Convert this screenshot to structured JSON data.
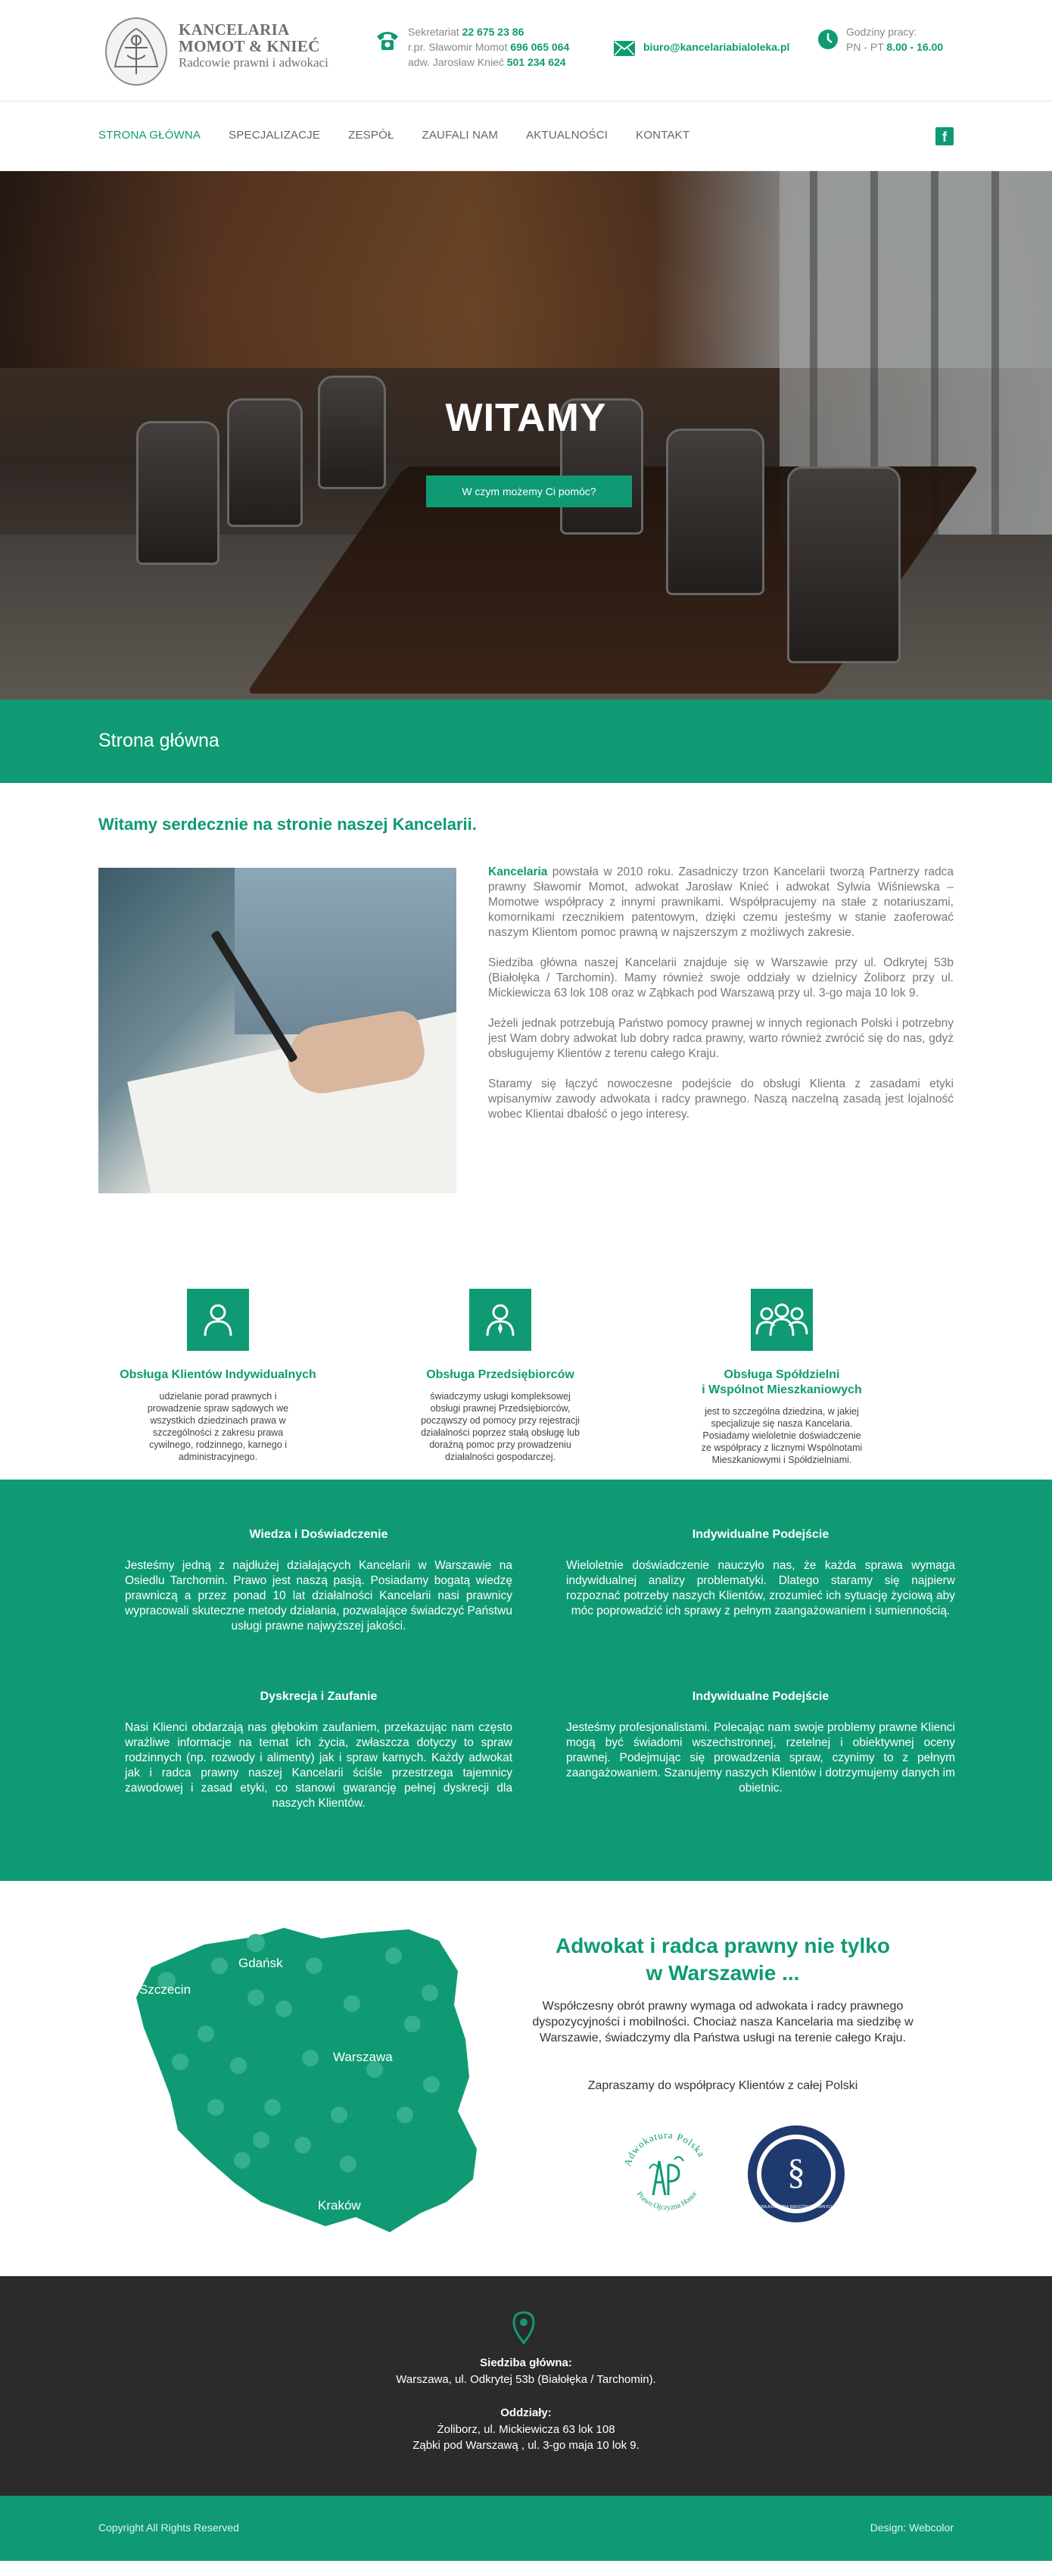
{
  "header": {
    "logo": {
      "line1": "KANCELARIA",
      "line2": "MOMOT & KNIEĆ",
      "line3": "Radcowie prawni i adwokaci"
    },
    "phone": {
      "label1": "Sekretariat",
      "num1": "22 675 23 86",
      "label2": "r.pr. Sławomir Momot",
      "num2": "696 065 064",
      "label3": "adw. Jarosław Knieć",
      "num3": "501 234 624"
    },
    "email": "biuro@kancelariabialoleka.pl",
    "hours": {
      "label": "Godziny pracy:",
      "days": "PN - PT",
      "time": "8.00 - 16.00"
    }
  },
  "nav": {
    "items": [
      {
        "label": "STRONA GŁÓWNA"
      },
      {
        "label": "SPECJALIZACJE"
      },
      {
        "label": "ZESPÓŁ"
      },
      {
        "label": "ZAUFALI NAM"
      },
      {
        "label": "AKTUALNOŚCI"
      },
      {
        "label": "KONTAKT"
      }
    ],
    "facebook": "f"
  },
  "hero": {
    "title": "WITAMY",
    "button": "W czym możemy Ci pomóc?"
  },
  "page_title": "Strona główna",
  "intro": {
    "heading": "Witamy serdecznie na stronie naszej Kancelarii.",
    "p1_bold": "Kancelaria",
    "p1": " powstała w 2010 roku. Zasadniczy trzon Kancelarii tworzą Partnerzy radca prawny Sławomir Momot, adwokat Jarosław Knieć i adwokat Sylwia Wiśniewska – Momotwe współpracy z innymi prawnikami. Współpracujemy na stałe z notariuszami, komornikami rzecznikiem patentowym, dzięki czemu jesteśmy w stanie zaoferować naszym Klientom pomoc prawną w najszerszym z możliwych zakresie.",
    "p2": "Siedziba główna naszej Kancelarii znajduje się w Warszawie przy ul. Odkrytej 53b (Białołęka / Tarchomin). Mamy również swoje oddziały w dzielnicy Żoliborz przy ul. Mickiewicza 63 lok 108 oraz w Ząbkach pod Warszawą przy ul. 3-go maja 10 lok 9.",
    "p3": "Jeżeli jednak potrzebują Państwo pomocy prawnej w innych regionach Polski i potrzebny jest Wam dobry adwokat lub dobry radca prawny, warto również zwrócić się do nas, gdyż obsługujemy Klientów z terenu całego Kraju.",
    "p4": "Staramy się łączyć nowoczesne podejście do obsługi Klienta z zasadami etyki wpisanymiw zawody adwokata i radcy prawnego. Naszą naczelną zasadą jest lojalność wobec Klientai dbałość o jego interesy."
  },
  "services": [
    {
      "title": "Obsługa Klientów Indywidualnych",
      "text": "udzielanie porad prawnych i prowadzenie spraw sądowych we wszystkich dziedzinach prawa w szczególności z zakresu prawa cywilnego, rodzinnego, karnego i administracyjnego."
    },
    {
      "title": "Obsługa Przedsiębiorców",
      "text": "świadczymy usługi kompleksowej obsługi prawnej Przedsiębiorców, począwszy od pomocy przy rejestracji działalności poprzez stałą obsługę lub doraźną pomoc przy prowadzeniu działalności gospodarczej."
    },
    {
      "title": "Obsługa Spółdzielni\ni Wspólnot Mieszkaniowych",
      "text": "jest to szczególna dziedzina, w jakiej specjalizuje się nasza Kancelaria. Posiadamy wieloletnie doświadczenie ze współpracy z licznymi Wspólnotami Mieszkaniowymi i Spółdzielniami."
    }
  ],
  "features": [
    {
      "title": "Wiedza i Doświadczenie",
      "text": "Jesteśmy jedną z najdłużej działających Kancelarii w Warszawie na Osiedlu Tarchomin. Prawo jest naszą pasją. Posiadamy bogatą wiedzę prawniczą a przez ponad 10 lat działalności Kancelarii nasi prawnicy wypracowali skuteczne metody działania, pozwalające świadczyć Państwu usługi prawne najwyższej jakości."
    },
    {
      "title": "Indywidualne Podejście",
      "text": "Wieloletnie doświadczenie nauczyło nas, że każda sprawa wymaga indywidualnej analizy problematyki. Dlatego staramy się najpierw rozpoznać potrzeby naszych Klientów, zrozumieć ich sytuację życiową aby móc poprowadzić ich sprawy z pełnym zaangażowaniem i sumiennością."
    },
    {
      "title": "Dyskrecja i Zaufanie",
      "text": "Nasi Klienci obdarzają nas głębokim zaufaniem, przekazując nam często wrażliwe informacje na temat ich życia, zwłaszcza dotyczy to spraw rodzinnych (np. rozwody i alimenty) jak i spraw karnych. Każdy adwokat jak i radca prawny naszej Kancelarii ściśle przestrzega tajemnicy zawodowej i zasad etyki, co stanowi gwarancję pełnej dyskrecji dla naszych Klientów."
    },
    {
      "title": "Indywidualne Podejście",
      "text": "Jesteśmy profesjonalistami. Polecając nam swoje problemy prawne Klienci mogą być świadomi wszechstronnej, rzetelnej i obiektywnej oceny prawnej. Podejmując się prowadzenia spraw, czynimy to z pełnym zaangażowaniem. Szanujemy naszych Klientów i dotrzymujemy danych im obietnic."
    }
  ],
  "map_section": {
    "cities": [
      "Gdańsk",
      "Szczecin",
      "Warszawa",
      "Kraków"
    ],
    "heading_l1": "Adwokat i radca prawny nie tylko",
    "heading_l2": "w Warszawie ...",
    "text": "Współczesny obrót prawny wymaga od adwokata i radcy prawnego dyspozycyjności i mobilności. Chociaż nasza Kancelaria ma siedzibę w Warszawie, świadczymy dla Państwa usługi na terenie całego Kraju.",
    "invite": "Zapraszamy do współpracy Klientów z całej Polski",
    "seal1_text": "Adwokatura Polska",
    "seal1_bottom": "Prawo Ojczyzna Honor",
    "seal2_text": "KRAJOWA IZBA RADCÓW PRAWNYCH"
  },
  "footer": {
    "hq_label": "Siedziba główna:",
    "hq_addr": "Warszawa, ul. Odkrytej 53b (Białołęka / Tarchomin).",
    "branches_label": "Oddziały:",
    "branch1": "Żoliborz, ul. Mickiewicza 63 lok 108",
    "branch2": "Ząbki pod Warszawą , ul. 3-go maja 10 lok 9.",
    "copyright": "Copyright All Rights Reserved",
    "design": "Design: Webcolor"
  },
  "colors": {
    "accent": "#0f9a74",
    "footer_dark": "#2b2b2b"
  }
}
